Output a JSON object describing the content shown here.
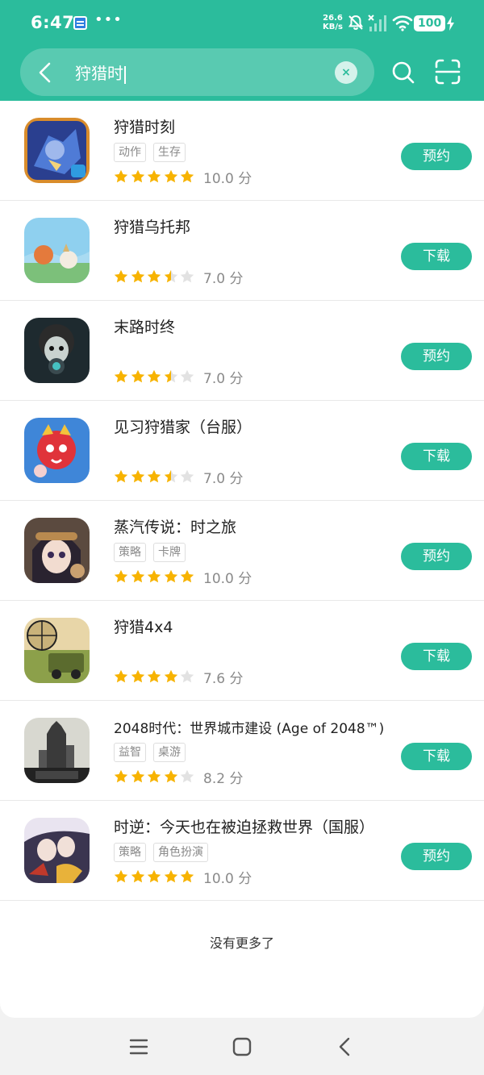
{
  "status_bar": {
    "time": "6:47",
    "net_speed_value": "26.6",
    "net_speed_unit": "KB/s",
    "battery": "100",
    "icons": [
      "notification-app-icon",
      "more-dots-icon",
      "mute-bell-icon",
      "no-signal-icon",
      "wifi-icon",
      "battery-icon",
      "charging-icon"
    ]
  },
  "search": {
    "query": "狩猎时",
    "clear_label": "×"
  },
  "colors": {
    "accent": "#2bbc9c",
    "star": "#f7b300",
    "star_empty": "#e2e2e2"
  },
  "apps": [
    {
      "title": "狩猎时刻",
      "tags": [
        "动作",
        "生存"
      ],
      "rating": 5,
      "score": "10.0 分",
      "action": "预约",
      "icon": "monster-hunt-icon"
    },
    {
      "title": "狩猎乌托邦",
      "tags": [],
      "rating": 3.5,
      "score": "7.0 分",
      "action": "下载",
      "icon": "fox-hunter-icon"
    },
    {
      "title": "末路时终",
      "tags": [],
      "rating": 3.5,
      "score": "7.0 分",
      "action": "预约",
      "icon": "dark-boy-icon"
    },
    {
      "title": "见习狩猎家（台服）",
      "tags": [],
      "rating": 3.5,
      "score": "7.0 分",
      "action": "下载",
      "icon": "red-dragon-icon"
    },
    {
      "title": "蒸汽传说：时之旅",
      "tags": [
        "策略",
        "卡牌"
      ],
      "rating": 5,
      "score": "10.0 分",
      "action": "预约",
      "icon": "steam-girl-icon"
    },
    {
      "title": "狩猎4x4",
      "tags": [],
      "rating": 4,
      "score": "7.6 分",
      "action": "下载",
      "icon": "jeep-scope-icon"
    },
    {
      "title": "2048时代：世界城市建设 (Age of 2048™)",
      "tags": [
        "益智",
        "桌游"
      ],
      "rating": 4,
      "score": "8.2 分",
      "action": "下载",
      "icon": "city-2048-icon"
    },
    {
      "title": "时逆：今天也在被迫拯救世界（国服）",
      "tags": [
        "策略",
        "角色扮演"
      ],
      "rating": 5,
      "score": "10.0 分",
      "action": "预约",
      "icon": "anime-duo-icon"
    }
  ],
  "list_end_text": "没有更多了",
  "nav_bar": {
    "icons": [
      "menu-icon",
      "home-icon",
      "back-icon"
    ]
  }
}
